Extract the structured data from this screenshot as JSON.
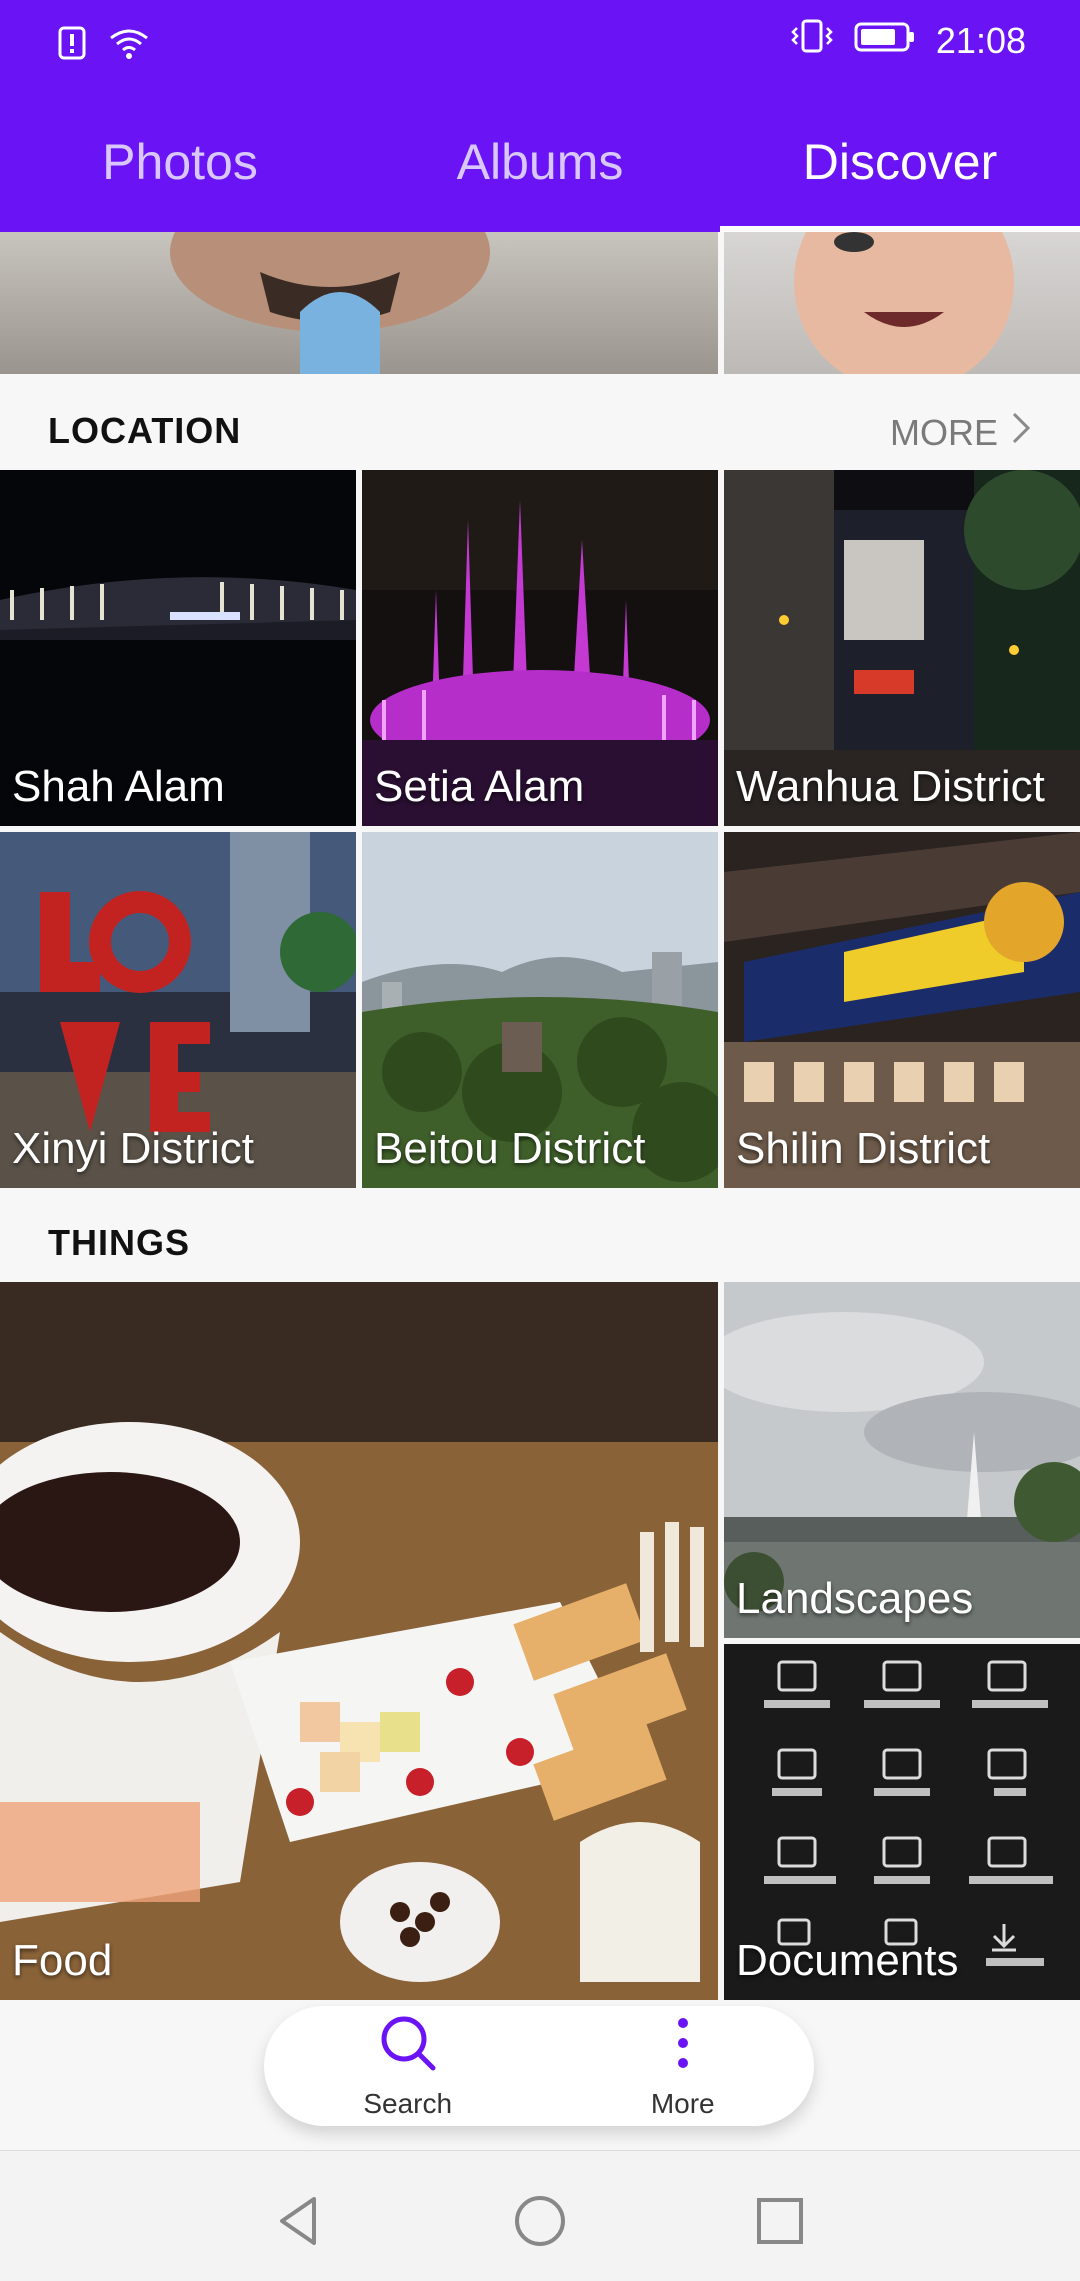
{
  "status": {
    "time": "21:08"
  },
  "tabs": [
    {
      "label": "Photos"
    },
    {
      "label": "Albums"
    },
    {
      "label": "Discover"
    }
  ],
  "location": {
    "title": "LOCATION",
    "more": "MORE",
    "places": [
      {
        "label": "Shah Alam"
      },
      {
        "label": "Setia Alam"
      },
      {
        "label": "Wanhua District"
      },
      {
        "label": "Xinyi District"
      },
      {
        "label": "Beitou District"
      },
      {
        "label": "Shilin District"
      }
    ]
  },
  "things": {
    "title": "THINGS",
    "items": [
      {
        "label": "Food"
      },
      {
        "label": "Landscapes"
      },
      {
        "label": "Documents"
      }
    ]
  },
  "bottom_bar": {
    "search_label": "Search",
    "more_label": "More"
  },
  "colors": {
    "accent": "#6a14f5"
  }
}
